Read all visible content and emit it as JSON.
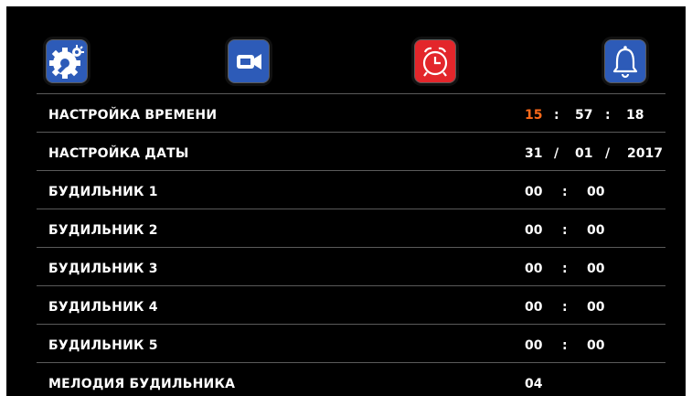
{
  "tabs": [
    {
      "name": "system-settings",
      "icon": "gear-tools-icon",
      "color": "#2d5bb8"
    },
    {
      "name": "camera",
      "icon": "video-camera-icon",
      "color": "#2d5bb8"
    },
    {
      "name": "alarm-clock",
      "icon": "alarm-clock-icon",
      "color": "#e3262b",
      "selected": true
    },
    {
      "name": "bell",
      "icon": "bell-icon",
      "color": "#2d5bb8"
    }
  ],
  "settings": {
    "time": {
      "label": "НАСТРОЙКА ВРЕМЕНИ",
      "hours": "15",
      "minutes": "57",
      "seconds": "18",
      "sep": ":"
    },
    "date": {
      "label": "НАСТРОЙКА ДАТЫ",
      "day": "31",
      "month": "01",
      "year": "2017",
      "sep": "/"
    },
    "alarm1": {
      "label": "БУДИЛЬНИК 1",
      "hours": "00",
      "minutes": "00",
      "sep": ":"
    },
    "alarm2": {
      "label": "БУДИЛЬНИК 2",
      "hours": "00",
      "minutes": "00",
      "sep": ":"
    },
    "alarm3": {
      "label": "БУДИЛЬНИК 3",
      "hours": "00",
      "minutes": "00",
      "sep": ":"
    },
    "alarm4": {
      "label": "БУДИЛЬНИК 4",
      "hours": "00",
      "minutes": "00",
      "sep": ":"
    },
    "alarm5": {
      "label": "БУДИЛЬНИК 5",
      "hours": "00",
      "minutes": "00",
      "sep": ":"
    },
    "melody": {
      "label": "МЕЛОДИЯ БУДИЛЬНИКА",
      "value": "04"
    }
  },
  "colors": {
    "background": "#000000",
    "text": "#ffffff",
    "highlight": "#ff6a1a",
    "tab_blue": "#2d5bb8",
    "tab_red": "#e3262b"
  }
}
